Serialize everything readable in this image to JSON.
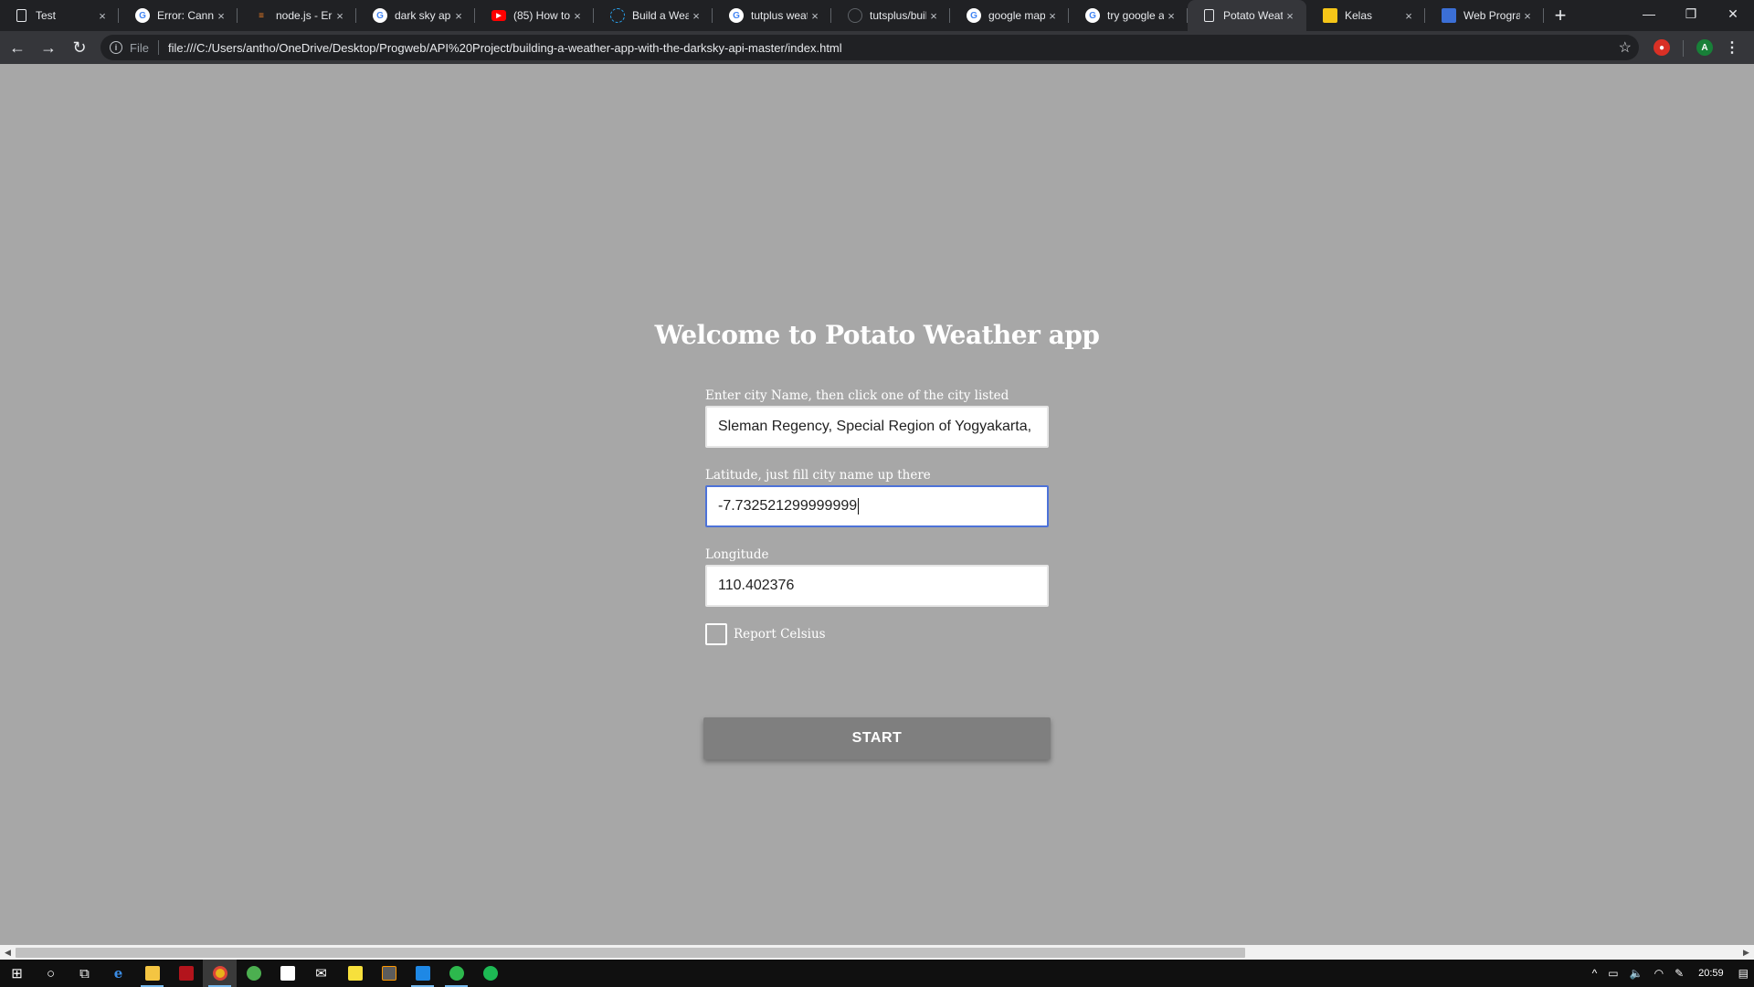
{
  "browser": {
    "tabs": [
      {
        "title": "Test",
        "favicon": "doc-icon"
      },
      {
        "title": "Error: Canno",
        "favicon": "google-icon"
      },
      {
        "title": "node.js - Err",
        "favicon": "stackoverflow-icon"
      },
      {
        "title": "dark sky api",
        "favicon": "google-icon"
      },
      {
        "title": "(85) How to",
        "favicon": "youtube-icon"
      },
      {
        "title": "Build a Weat",
        "favicon": "darksky-icon"
      },
      {
        "title": "tutplus weat",
        "favicon": "google-icon"
      },
      {
        "title": "tutsplus/buil",
        "favicon": "github-icon"
      },
      {
        "title": "google map",
        "favicon": "google-icon"
      },
      {
        "title": "try google a",
        "favicon": "google-icon"
      },
      {
        "title": "Potato Weat",
        "favicon": "doc-icon",
        "active": true
      },
      {
        "title": "Kelas",
        "favicon": "classroom-icon"
      },
      {
        "title": "Web Progra",
        "favicon": "classroom-icon"
      }
    ],
    "close_glyph": "×",
    "new_tab_glyph": "+",
    "address": {
      "scheme_label": "File",
      "url": "file:///C:/Users/antho/OneDrive/Desktop/Progweb/API%20Project/building-a-weather-app-with-the-darksky-api-master/index.html"
    },
    "profile_initial": "A"
  },
  "page": {
    "heading": "Welcome to Potato Weather app",
    "city": {
      "label": "Enter city Name, then click one of the city listed",
      "value": "Sleman Regency, Special Region of Yogyakarta,"
    },
    "latitude": {
      "label": "Latitude, just fill city name up there",
      "value": "-7.732521299999999"
    },
    "longitude": {
      "label": "Longitude",
      "value": "110.402376"
    },
    "celsius": {
      "label": "Report Celsius",
      "checked": false
    },
    "start_button": "START"
  },
  "taskbar": {
    "clock": "20:59"
  },
  "colors": {
    "page_background": "#a7a7a7",
    "button_background": "#7f7f7f",
    "focus_border": "#4d72d8"
  }
}
